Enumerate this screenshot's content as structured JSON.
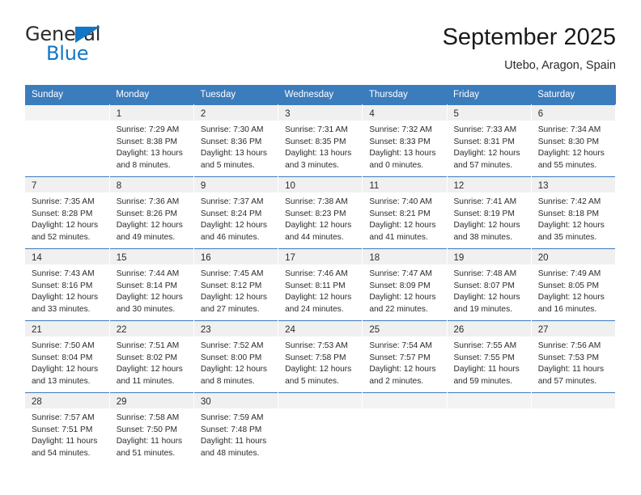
{
  "brand": {
    "name_part1": "General",
    "name_part2": "Blue",
    "triangle_icon": "triangle-icon",
    "accent_color": "#1277c4"
  },
  "header": {
    "title": "September 2025",
    "subtitle": "Utebo, Aragon, Spain"
  },
  "theme": {
    "header_blue": "#3b7cbd",
    "daynum_band": "#f0f0f0",
    "text": "#2b2b2b"
  },
  "calendar": {
    "weekday_headers": [
      "Sunday",
      "Monday",
      "Tuesday",
      "Wednesday",
      "Thursday",
      "Friday",
      "Saturday"
    ],
    "weeks": [
      [
        {
          "day": "",
          "lines": []
        },
        {
          "day": "1",
          "lines": [
            "Sunrise: 7:29 AM",
            "Sunset: 8:38 PM",
            "Daylight: 13 hours",
            "and 8 minutes."
          ]
        },
        {
          "day": "2",
          "lines": [
            "Sunrise: 7:30 AM",
            "Sunset: 8:36 PM",
            "Daylight: 13 hours",
            "and 5 minutes."
          ]
        },
        {
          "day": "3",
          "lines": [
            "Sunrise: 7:31 AM",
            "Sunset: 8:35 PM",
            "Daylight: 13 hours",
            "and 3 minutes."
          ]
        },
        {
          "day": "4",
          "lines": [
            "Sunrise: 7:32 AM",
            "Sunset: 8:33 PM",
            "Daylight: 13 hours",
            "and 0 minutes."
          ]
        },
        {
          "day": "5",
          "lines": [
            "Sunrise: 7:33 AM",
            "Sunset: 8:31 PM",
            "Daylight: 12 hours",
            "and 57 minutes."
          ]
        },
        {
          "day": "6",
          "lines": [
            "Sunrise: 7:34 AM",
            "Sunset: 8:30 PM",
            "Daylight: 12 hours",
            "and 55 minutes."
          ]
        }
      ],
      [
        {
          "day": "7",
          "lines": [
            "Sunrise: 7:35 AM",
            "Sunset: 8:28 PM",
            "Daylight: 12 hours",
            "and 52 minutes."
          ]
        },
        {
          "day": "8",
          "lines": [
            "Sunrise: 7:36 AM",
            "Sunset: 8:26 PM",
            "Daylight: 12 hours",
            "and 49 minutes."
          ]
        },
        {
          "day": "9",
          "lines": [
            "Sunrise: 7:37 AM",
            "Sunset: 8:24 PM",
            "Daylight: 12 hours",
            "and 46 minutes."
          ]
        },
        {
          "day": "10",
          "lines": [
            "Sunrise: 7:38 AM",
            "Sunset: 8:23 PM",
            "Daylight: 12 hours",
            "and 44 minutes."
          ]
        },
        {
          "day": "11",
          "lines": [
            "Sunrise: 7:40 AM",
            "Sunset: 8:21 PM",
            "Daylight: 12 hours",
            "and 41 minutes."
          ]
        },
        {
          "day": "12",
          "lines": [
            "Sunrise: 7:41 AM",
            "Sunset: 8:19 PM",
            "Daylight: 12 hours",
            "and 38 minutes."
          ]
        },
        {
          "day": "13",
          "lines": [
            "Sunrise: 7:42 AM",
            "Sunset: 8:18 PM",
            "Daylight: 12 hours",
            "and 35 minutes."
          ]
        }
      ],
      [
        {
          "day": "14",
          "lines": [
            "Sunrise: 7:43 AM",
            "Sunset: 8:16 PM",
            "Daylight: 12 hours",
            "and 33 minutes."
          ]
        },
        {
          "day": "15",
          "lines": [
            "Sunrise: 7:44 AM",
            "Sunset: 8:14 PM",
            "Daylight: 12 hours",
            "and 30 minutes."
          ]
        },
        {
          "day": "16",
          "lines": [
            "Sunrise: 7:45 AM",
            "Sunset: 8:12 PM",
            "Daylight: 12 hours",
            "and 27 minutes."
          ]
        },
        {
          "day": "17",
          "lines": [
            "Sunrise: 7:46 AM",
            "Sunset: 8:11 PM",
            "Daylight: 12 hours",
            "and 24 minutes."
          ]
        },
        {
          "day": "18",
          "lines": [
            "Sunrise: 7:47 AM",
            "Sunset: 8:09 PM",
            "Daylight: 12 hours",
            "and 22 minutes."
          ]
        },
        {
          "day": "19",
          "lines": [
            "Sunrise: 7:48 AM",
            "Sunset: 8:07 PM",
            "Daylight: 12 hours",
            "and 19 minutes."
          ]
        },
        {
          "day": "20",
          "lines": [
            "Sunrise: 7:49 AM",
            "Sunset: 8:05 PM",
            "Daylight: 12 hours",
            "and 16 minutes."
          ]
        }
      ],
      [
        {
          "day": "21",
          "lines": [
            "Sunrise: 7:50 AM",
            "Sunset: 8:04 PM",
            "Daylight: 12 hours",
            "and 13 minutes."
          ]
        },
        {
          "day": "22",
          "lines": [
            "Sunrise: 7:51 AM",
            "Sunset: 8:02 PM",
            "Daylight: 12 hours",
            "and 11 minutes."
          ]
        },
        {
          "day": "23",
          "lines": [
            "Sunrise: 7:52 AM",
            "Sunset: 8:00 PM",
            "Daylight: 12 hours",
            "and 8 minutes."
          ]
        },
        {
          "day": "24",
          "lines": [
            "Sunrise: 7:53 AM",
            "Sunset: 7:58 PM",
            "Daylight: 12 hours",
            "and 5 minutes."
          ]
        },
        {
          "day": "25",
          "lines": [
            "Sunrise: 7:54 AM",
            "Sunset: 7:57 PM",
            "Daylight: 12 hours",
            "and 2 minutes."
          ]
        },
        {
          "day": "26",
          "lines": [
            "Sunrise: 7:55 AM",
            "Sunset: 7:55 PM",
            "Daylight: 11 hours",
            "and 59 minutes."
          ]
        },
        {
          "day": "27",
          "lines": [
            "Sunrise: 7:56 AM",
            "Sunset: 7:53 PM",
            "Daylight: 11 hours",
            "and 57 minutes."
          ]
        }
      ],
      [
        {
          "day": "28",
          "lines": [
            "Sunrise: 7:57 AM",
            "Sunset: 7:51 PM",
            "Daylight: 11 hours",
            "and 54 minutes."
          ]
        },
        {
          "day": "29",
          "lines": [
            "Sunrise: 7:58 AM",
            "Sunset: 7:50 PM",
            "Daylight: 11 hours",
            "and 51 minutes."
          ]
        },
        {
          "day": "30",
          "lines": [
            "Sunrise: 7:59 AM",
            "Sunset: 7:48 PM",
            "Daylight: 11 hours",
            "and 48 minutes."
          ]
        },
        {
          "day": "",
          "lines": []
        },
        {
          "day": "",
          "lines": []
        },
        {
          "day": "",
          "lines": []
        },
        {
          "day": "",
          "lines": []
        }
      ]
    ]
  }
}
